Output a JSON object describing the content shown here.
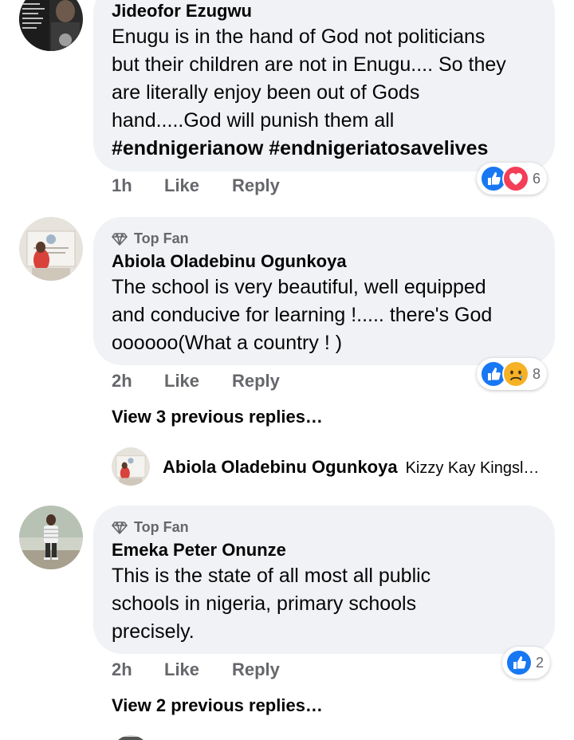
{
  "comments": [
    {
      "author": "Jideofor Ezugwu",
      "badge": "",
      "text_lines": [
        "Enugu is in the hand of God not politicians",
        "but their children are not in Enugu.... So they",
        "are literally enjoy been out of Gods",
        "hand.....God will punish them all"
      ],
      "hashtags": "#endnigerianow #endnigeriatosavelives",
      "time": "1h",
      "like_label": "Like",
      "reply_label": "Reply",
      "reactions": [
        "like",
        "love"
      ],
      "reaction_count": "6"
    },
    {
      "author": "Abiola Oladebinu Ogunkoya",
      "badge": "Top Fan",
      "text_lines": [
        "The school is very beautiful, well equipped",
        "and conducive for learning !..... there's God",
        "oooooo(What a country ! )"
      ],
      "time": "2h",
      "like_label": "Like",
      "reply_label": "Reply",
      "reactions": [
        "like",
        "sad"
      ],
      "reaction_count": "8",
      "view_previous": "View 3 previous replies…",
      "reply_preview": {
        "author": "Abiola Oladebinu Ogunkoya",
        "text": "Kizzy Kay Kingsl…"
      }
    },
    {
      "author": "Emeka Peter Onunze",
      "badge": "Top Fan",
      "text_lines": [
        "This is the state of all most all public",
        "schools in nigeria, primary schools",
        "precisely."
      ],
      "time": "2h",
      "like_label": "Like",
      "reply_label": "Reply",
      "reactions": [
        "like"
      ],
      "reaction_count": "2",
      "view_previous": "View 2 previous replies…"
    }
  ],
  "colors": {
    "bubble": "#f0f2f5",
    "meta": "#65676b",
    "like_blue": "#1877f2",
    "love_red": "#f33e58",
    "sad_yellow": "#f7b125"
  },
  "icons": {
    "top_fan": "diamond-icon",
    "like": "thumbs-up-icon",
    "love": "heart-icon",
    "sad": "sad-face-icon"
  }
}
